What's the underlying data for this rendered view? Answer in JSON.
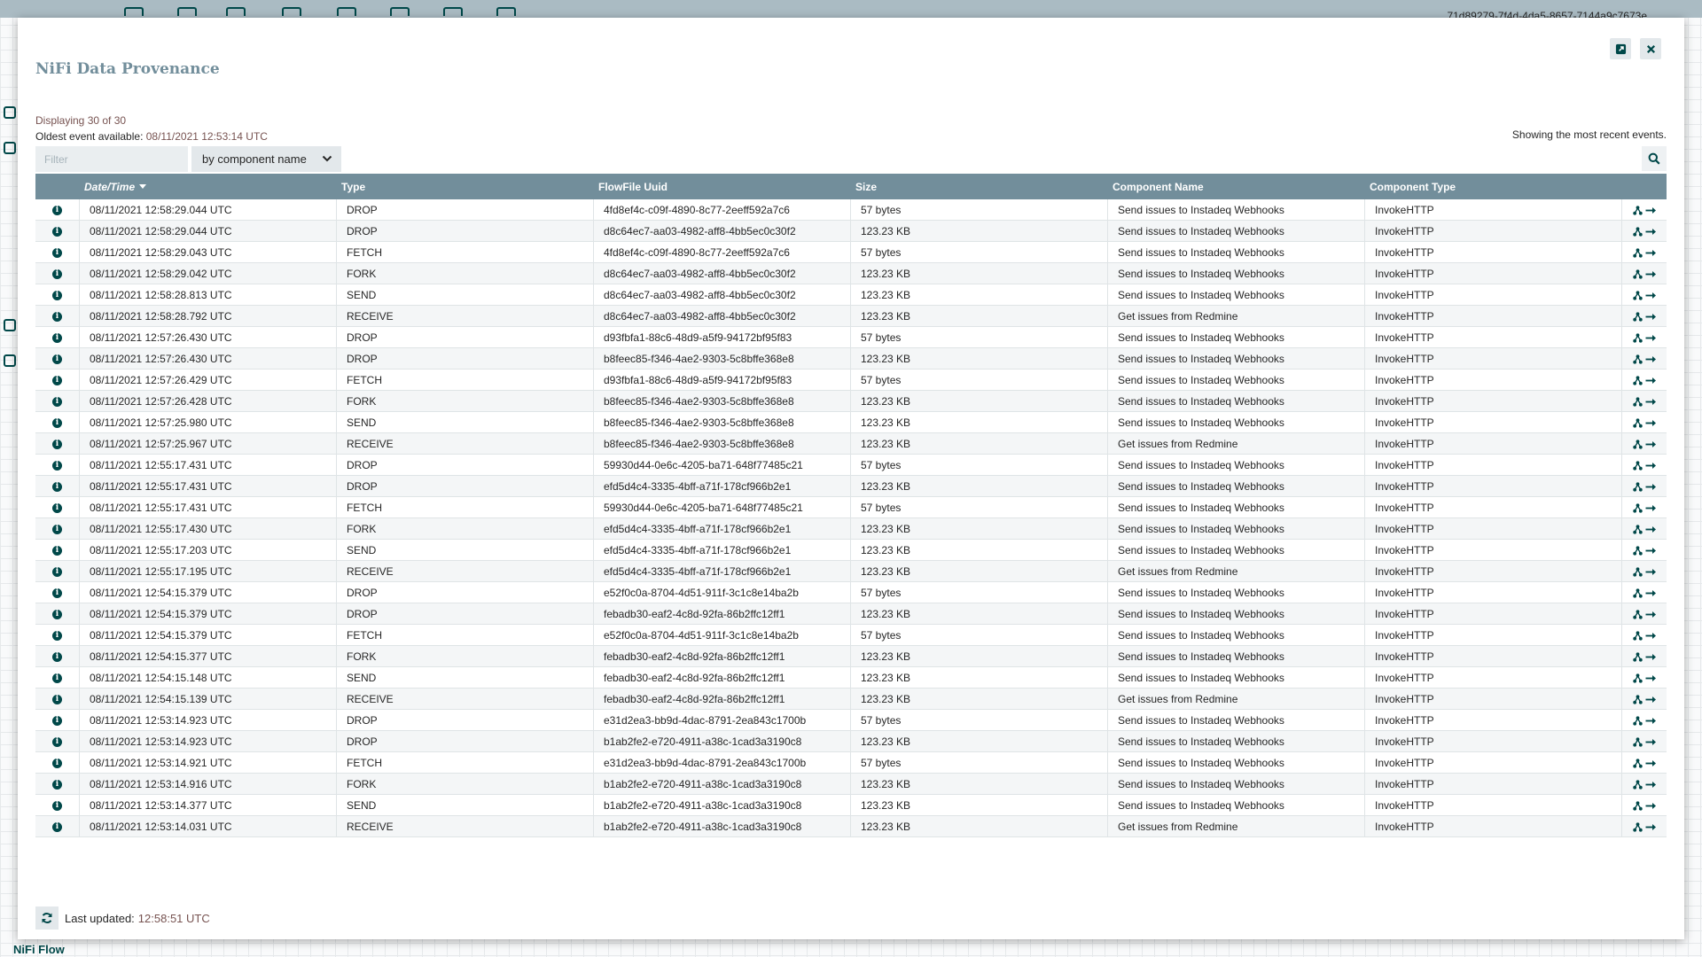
{
  "app": {
    "flow_id": "71d89279-7f4d-4da5-8657-7144a9c7673e",
    "breadcrumb": "NiFi Flow"
  },
  "dialog": {
    "title": "NiFi Data Provenance",
    "displaying": "Displaying 30 of 30",
    "oldest_label": "Oldest event available: ",
    "oldest_value": "08/11/2021 12:53:14 UTC",
    "recent_note": "Showing the most recent events.",
    "filter_placeholder": "Filter",
    "filter_by": "by component name",
    "last_updated_label": "Last updated:",
    "last_updated_value": "12:58:51 UTC"
  },
  "table": {
    "columns": [
      "Date/Time",
      "Type",
      "FlowFile Uuid",
      "Size",
      "Component Name",
      "Component Type"
    ],
    "sort_column": "Date/Time",
    "sort_direction": "descending",
    "rows": [
      {
        "datetime": "08/11/2021 12:58:29.044 UTC",
        "type": "DROP",
        "uuid": "4fd8ef4c-c09f-4890-8c77-2eeff592a7c6",
        "size": "57 bytes",
        "component": "Send issues to Instadeq Webhooks",
        "ctype": "InvokeHTTP"
      },
      {
        "datetime": "08/11/2021 12:58:29.044 UTC",
        "type": "DROP",
        "uuid": "d8c64ec7-aa03-4982-aff8-4bb5ec0c30f2",
        "size": "123.23 KB",
        "component": "Send issues to Instadeq Webhooks",
        "ctype": "InvokeHTTP"
      },
      {
        "datetime": "08/11/2021 12:58:29.043 UTC",
        "type": "FETCH",
        "uuid": "4fd8ef4c-c09f-4890-8c77-2eeff592a7c6",
        "size": "57 bytes",
        "component": "Send issues to Instadeq Webhooks",
        "ctype": "InvokeHTTP"
      },
      {
        "datetime": "08/11/2021 12:58:29.042 UTC",
        "type": "FORK",
        "uuid": "d8c64ec7-aa03-4982-aff8-4bb5ec0c30f2",
        "size": "123.23 KB",
        "component": "Send issues to Instadeq Webhooks",
        "ctype": "InvokeHTTP"
      },
      {
        "datetime": "08/11/2021 12:58:28.813 UTC",
        "type": "SEND",
        "uuid": "d8c64ec7-aa03-4982-aff8-4bb5ec0c30f2",
        "size": "123.23 KB",
        "component": "Send issues to Instadeq Webhooks",
        "ctype": "InvokeHTTP"
      },
      {
        "datetime": "08/11/2021 12:58:28.792 UTC",
        "type": "RECEIVE",
        "uuid": "d8c64ec7-aa03-4982-aff8-4bb5ec0c30f2",
        "size": "123.23 KB",
        "component": "Get issues from Redmine",
        "ctype": "InvokeHTTP"
      },
      {
        "datetime": "08/11/2021 12:57:26.430 UTC",
        "type": "DROP",
        "uuid": "d93fbfa1-88c6-48d9-a5f9-94172bf95f83",
        "size": "57 bytes",
        "component": "Send issues to Instadeq Webhooks",
        "ctype": "InvokeHTTP"
      },
      {
        "datetime": "08/11/2021 12:57:26.430 UTC",
        "type": "DROP",
        "uuid": "b8feec85-f346-4ae2-9303-5c8bffe368e8",
        "size": "123.23 KB",
        "component": "Send issues to Instadeq Webhooks",
        "ctype": "InvokeHTTP"
      },
      {
        "datetime": "08/11/2021 12:57:26.429 UTC",
        "type": "FETCH",
        "uuid": "d93fbfa1-88c6-48d9-a5f9-94172bf95f83",
        "size": "57 bytes",
        "component": "Send issues to Instadeq Webhooks",
        "ctype": "InvokeHTTP"
      },
      {
        "datetime": "08/11/2021 12:57:26.428 UTC",
        "type": "FORK",
        "uuid": "b8feec85-f346-4ae2-9303-5c8bffe368e8",
        "size": "123.23 KB",
        "component": "Send issues to Instadeq Webhooks",
        "ctype": "InvokeHTTP"
      },
      {
        "datetime": "08/11/2021 12:57:25.980 UTC",
        "type": "SEND",
        "uuid": "b8feec85-f346-4ae2-9303-5c8bffe368e8",
        "size": "123.23 KB",
        "component": "Send issues to Instadeq Webhooks",
        "ctype": "InvokeHTTP"
      },
      {
        "datetime": "08/11/2021 12:57:25.967 UTC",
        "type": "RECEIVE",
        "uuid": "b8feec85-f346-4ae2-9303-5c8bffe368e8",
        "size": "123.23 KB",
        "component": "Get issues from Redmine",
        "ctype": "InvokeHTTP"
      },
      {
        "datetime": "08/11/2021 12:55:17.431 UTC",
        "type": "DROP",
        "uuid": "59930d44-0e6c-4205-ba71-648f77485c21",
        "size": "57 bytes",
        "component": "Send issues to Instadeq Webhooks",
        "ctype": "InvokeHTTP"
      },
      {
        "datetime": "08/11/2021 12:55:17.431 UTC",
        "type": "DROP",
        "uuid": "efd5d4c4-3335-4bff-a71f-178cf966b2e1",
        "size": "123.23 KB",
        "component": "Send issues to Instadeq Webhooks",
        "ctype": "InvokeHTTP"
      },
      {
        "datetime": "08/11/2021 12:55:17.431 UTC",
        "type": "FETCH",
        "uuid": "59930d44-0e6c-4205-ba71-648f77485c21",
        "size": "57 bytes",
        "component": "Send issues to Instadeq Webhooks",
        "ctype": "InvokeHTTP"
      },
      {
        "datetime": "08/11/2021 12:55:17.430 UTC",
        "type": "FORK",
        "uuid": "efd5d4c4-3335-4bff-a71f-178cf966b2e1",
        "size": "123.23 KB",
        "component": "Send issues to Instadeq Webhooks",
        "ctype": "InvokeHTTP"
      },
      {
        "datetime": "08/11/2021 12:55:17.203 UTC",
        "type": "SEND",
        "uuid": "efd5d4c4-3335-4bff-a71f-178cf966b2e1",
        "size": "123.23 KB",
        "component": "Send issues to Instadeq Webhooks",
        "ctype": "InvokeHTTP"
      },
      {
        "datetime": "08/11/2021 12:55:17.195 UTC",
        "type": "RECEIVE",
        "uuid": "efd5d4c4-3335-4bff-a71f-178cf966b2e1",
        "size": "123.23 KB",
        "component": "Get issues from Redmine",
        "ctype": "InvokeHTTP"
      },
      {
        "datetime": "08/11/2021 12:54:15.379 UTC",
        "type": "DROP",
        "uuid": "e52f0c0a-8704-4d51-911f-3c1c8e14ba2b",
        "size": "57 bytes",
        "component": "Send issues to Instadeq Webhooks",
        "ctype": "InvokeHTTP"
      },
      {
        "datetime": "08/11/2021 12:54:15.379 UTC",
        "type": "DROP",
        "uuid": "febadb30-eaf2-4c8d-92fa-86b2ffc12ff1",
        "size": "123.23 KB",
        "component": "Send issues to Instadeq Webhooks",
        "ctype": "InvokeHTTP"
      },
      {
        "datetime": "08/11/2021 12:54:15.379 UTC",
        "type": "FETCH",
        "uuid": "e52f0c0a-8704-4d51-911f-3c1c8e14ba2b",
        "size": "57 bytes",
        "component": "Send issues to Instadeq Webhooks",
        "ctype": "InvokeHTTP"
      },
      {
        "datetime": "08/11/2021 12:54:15.377 UTC",
        "type": "FORK",
        "uuid": "febadb30-eaf2-4c8d-92fa-86b2ffc12ff1",
        "size": "123.23 KB",
        "component": "Send issues to Instadeq Webhooks",
        "ctype": "InvokeHTTP"
      },
      {
        "datetime": "08/11/2021 12:54:15.148 UTC",
        "type": "SEND",
        "uuid": "febadb30-eaf2-4c8d-92fa-86b2ffc12ff1",
        "size": "123.23 KB",
        "component": "Send issues to Instadeq Webhooks",
        "ctype": "InvokeHTTP"
      },
      {
        "datetime": "08/11/2021 12:54:15.139 UTC",
        "type": "RECEIVE",
        "uuid": "febadb30-eaf2-4c8d-92fa-86b2ffc12ff1",
        "size": "123.23 KB",
        "component": "Get issues from Redmine",
        "ctype": "InvokeHTTP"
      },
      {
        "datetime": "08/11/2021 12:53:14.923 UTC",
        "type": "DROP",
        "uuid": "e31d2ea3-bb9d-4dac-8791-2ea843c1700b",
        "size": "57 bytes",
        "component": "Send issues to Instadeq Webhooks",
        "ctype": "InvokeHTTP"
      },
      {
        "datetime": "08/11/2021 12:53:14.923 UTC",
        "type": "DROP",
        "uuid": "b1ab2fe2-e720-4911-a38c-1cad3a3190c8",
        "size": "123.23 KB",
        "component": "Send issues to Instadeq Webhooks",
        "ctype": "InvokeHTTP"
      },
      {
        "datetime": "08/11/2021 12:53:14.921 UTC",
        "type": "FETCH",
        "uuid": "e31d2ea3-bb9d-4dac-8791-2ea843c1700b",
        "size": "57 bytes",
        "component": "Send issues to Instadeq Webhooks",
        "ctype": "InvokeHTTP"
      },
      {
        "datetime": "08/11/2021 12:53:14.916 UTC",
        "type": "FORK",
        "uuid": "b1ab2fe2-e720-4911-a38c-1cad3a3190c8",
        "size": "123.23 KB",
        "component": "Send issues to Instadeq Webhooks",
        "ctype": "InvokeHTTP"
      },
      {
        "datetime": "08/11/2021 12:53:14.377 UTC",
        "type": "SEND",
        "uuid": "b1ab2fe2-e720-4911-a38c-1cad3a3190c8",
        "size": "123.23 KB",
        "component": "Send issues to Instadeq Webhooks",
        "ctype": "InvokeHTTP"
      },
      {
        "datetime": "08/11/2021 12:53:14.031 UTC",
        "type": "RECEIVE",
        "uuid": "b1ab2fe2-e720-4911-a38c-1cad3a3190c8",
        "size": "123.23 KB",
        "component": "Get issues from Redmine",
        "ctype": "InvokeHTTP"
      }
    ]
  },
  "icons": {
    "row_info": "info-icon",
    "row_lineage": "lineage-icon",
    "row_goto": "go-to-arrow-icon",
    "expand": "expand-icon",
    "close": "close-icon",
    "search": "search-icon",
    "refresh": "refresh-icon",
    "dropdown": "chevron-down-icon"
  },
  "colors": {
    "header_bg": "#728e9b",
    "title": "#728e9b",
    "accent_text": "#775351",
    "icon_dark": "#004849"
  }
}
